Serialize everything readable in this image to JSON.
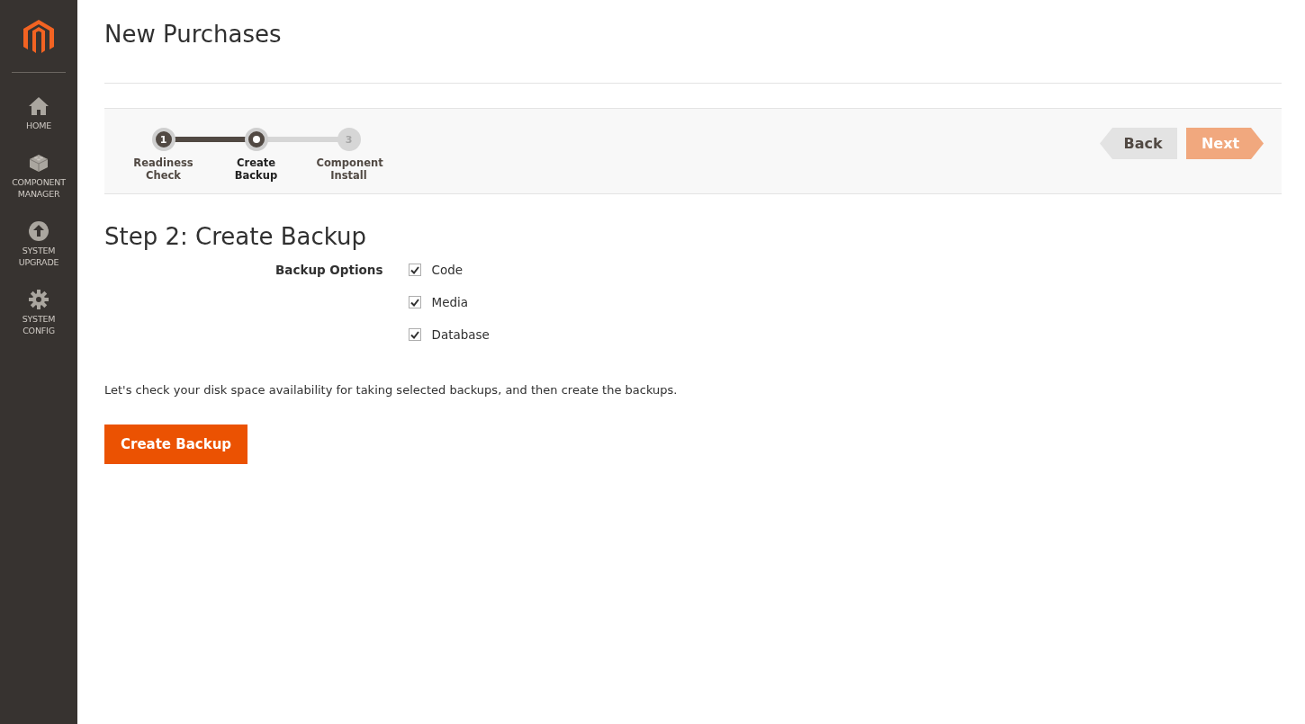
{
  "sidebar": {
    "items": [
      {
        "label": "HOME",
        "kind": "home"
      },
      {
        "label": "COMPONENT MANAGER",
        "kind": "block"
      },
      {
        "label": "SYSTEM UPGRADE",
        "kind": "upgrade"
      },
      {
        "label": "SYSTEM CONFIG",
        "kind": "gear"
      }
    ]
  },
  "page_title": "New Purchases",
  "steps": [
    {
      "number": "1",
      "label": "Readiness Check",
      "completed": true,
      "selected": false
    },
    {
      "label": "Create Backup",
      "completed": false,
      "selected": true
    },
    {
      "number": "3",
      "label": "Component Install",
      "completed": false,
      "selected": false
    }
  ],
  "nav_buttons": {
    "back": {
      "label": "Back",
      "disabled": false
    },
    "next": {
      "label": "Next",
      "disabled": true
    }
  },
  "step_heading": "Step 2: Create Backup",
  "backup_options": {
    "label": "Backup Options",
    "options": [
      {
        "label": "Code",
        "checked": true
      },
      {
        "label": "Media",
        "checked": true
      },
      {
        "label": "Database",
        "checked": true
      }
    ]
  },
  "description": "Let's check your disk space availability for taking selected backups, and then create the backups.",
  "create_button": "Create Backup"
}
